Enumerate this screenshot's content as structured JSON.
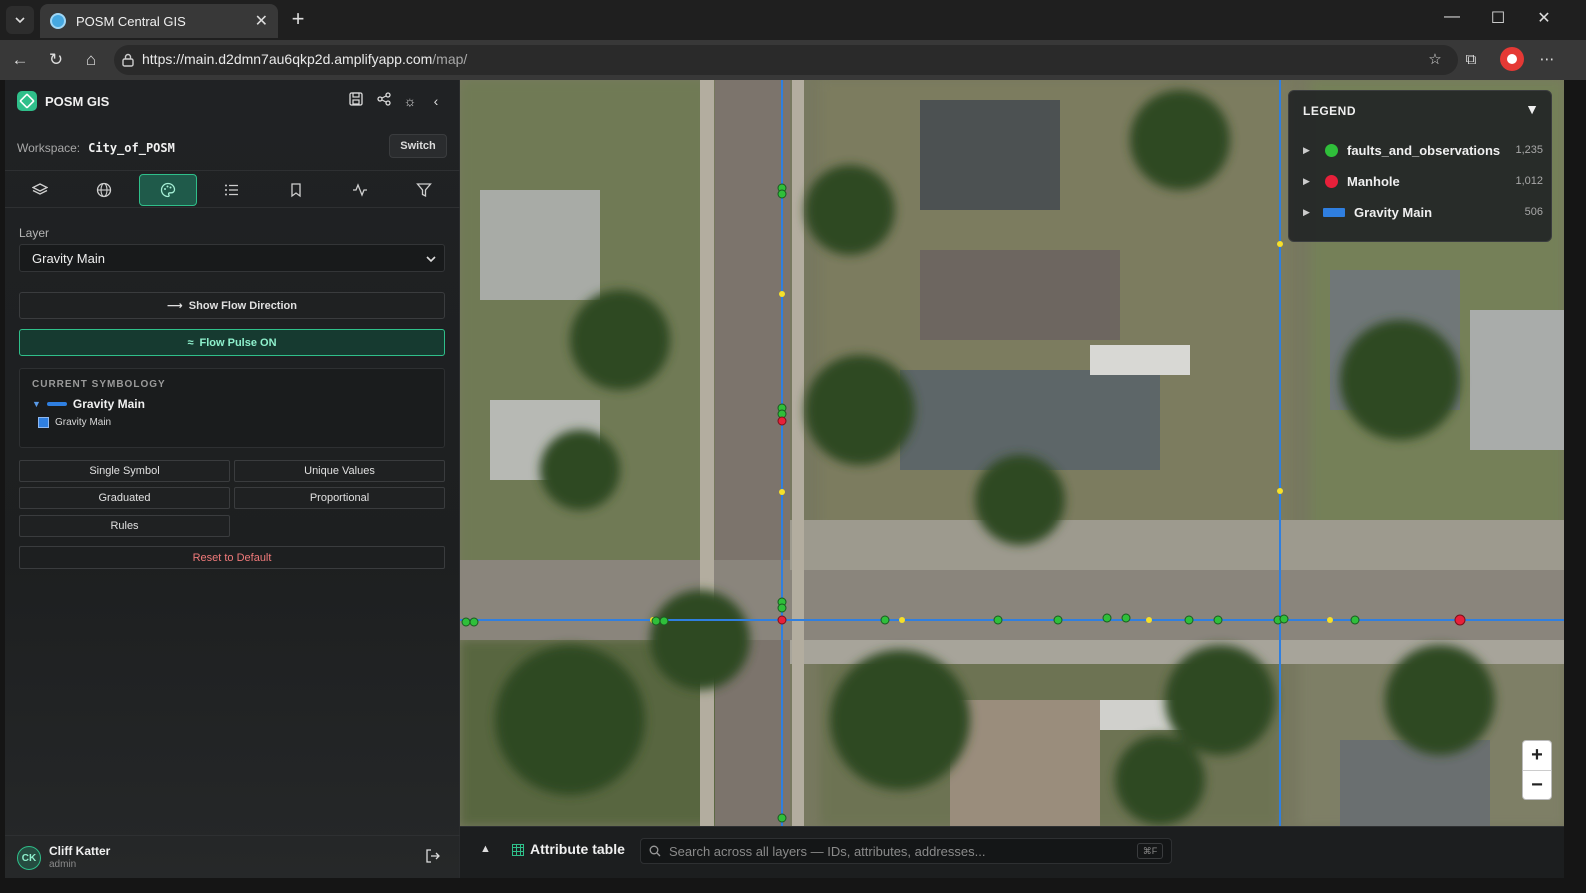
{
  "browser": {
    "tab_title": "POSM Central GIS",
    "url_host": "https://main.d2dmn7au6qkp2d.amplifyapp.com",
    "url_path": "/map/"
  },
  "sidebar": {
    "brand": "POSM GIS",
    "workspace_label": "Workspace:",
    "workspace_name": "City_of_POSM",
    "switch_label": "Switch",
    "layer_label": "Layer",
    "layer_selected": "Gravity Main",
    "flow_direction_label": "Show Flow Direction",
    "flow_pulse_label": "Flow Pulse ON",
    "symbology": {
      "title": "CURRENT SYMBOLOGY",
      "group_name": "Gravity Main",
      "item_name": "Gravity Main",
      "line_color": "#2f7fe0"
    },
    "style_buttons": {
      "single": "Single Symbol",
      "unique": "Unique Values",
      "graduated": "Graduated",
      "proportional": "Proportional",
      "rules": "Rules"
    },
    "reset_label": "Reset to Default",
    "user": {
      "initials": "CK",
      "name": "Cliff Katter",
      "role": "admin"
    }
  },
  "legend": {
    "title": "LEGEND",
    "items": [
      {
        "name": "faults_and_observations",
        "count": "1,235",
        "color": "#2fbf3a"
      },
      {
        "name": "Manhole",
        "count": "1,012",
        "color": "#e8203a"
      },
      {
        "name": "Gravity Main",
        "count": "506",
        "color": "#2f7fe0"
      }
    ]
  },
  "bottombar": {
    "title": "Attribute table",
    "search_placeholder": "Search across all layers — IDs, attributes, addresses...",
    "kbd": "⌘F"
  },
  "colors": {
    "accent": "#2fbf8a",
    "pipe": "#2f7fe0",
    "observation": "#2fbf3a",
    "manhole": "#e8203a",
    "vertex": "#f5e02a"
  }
}
